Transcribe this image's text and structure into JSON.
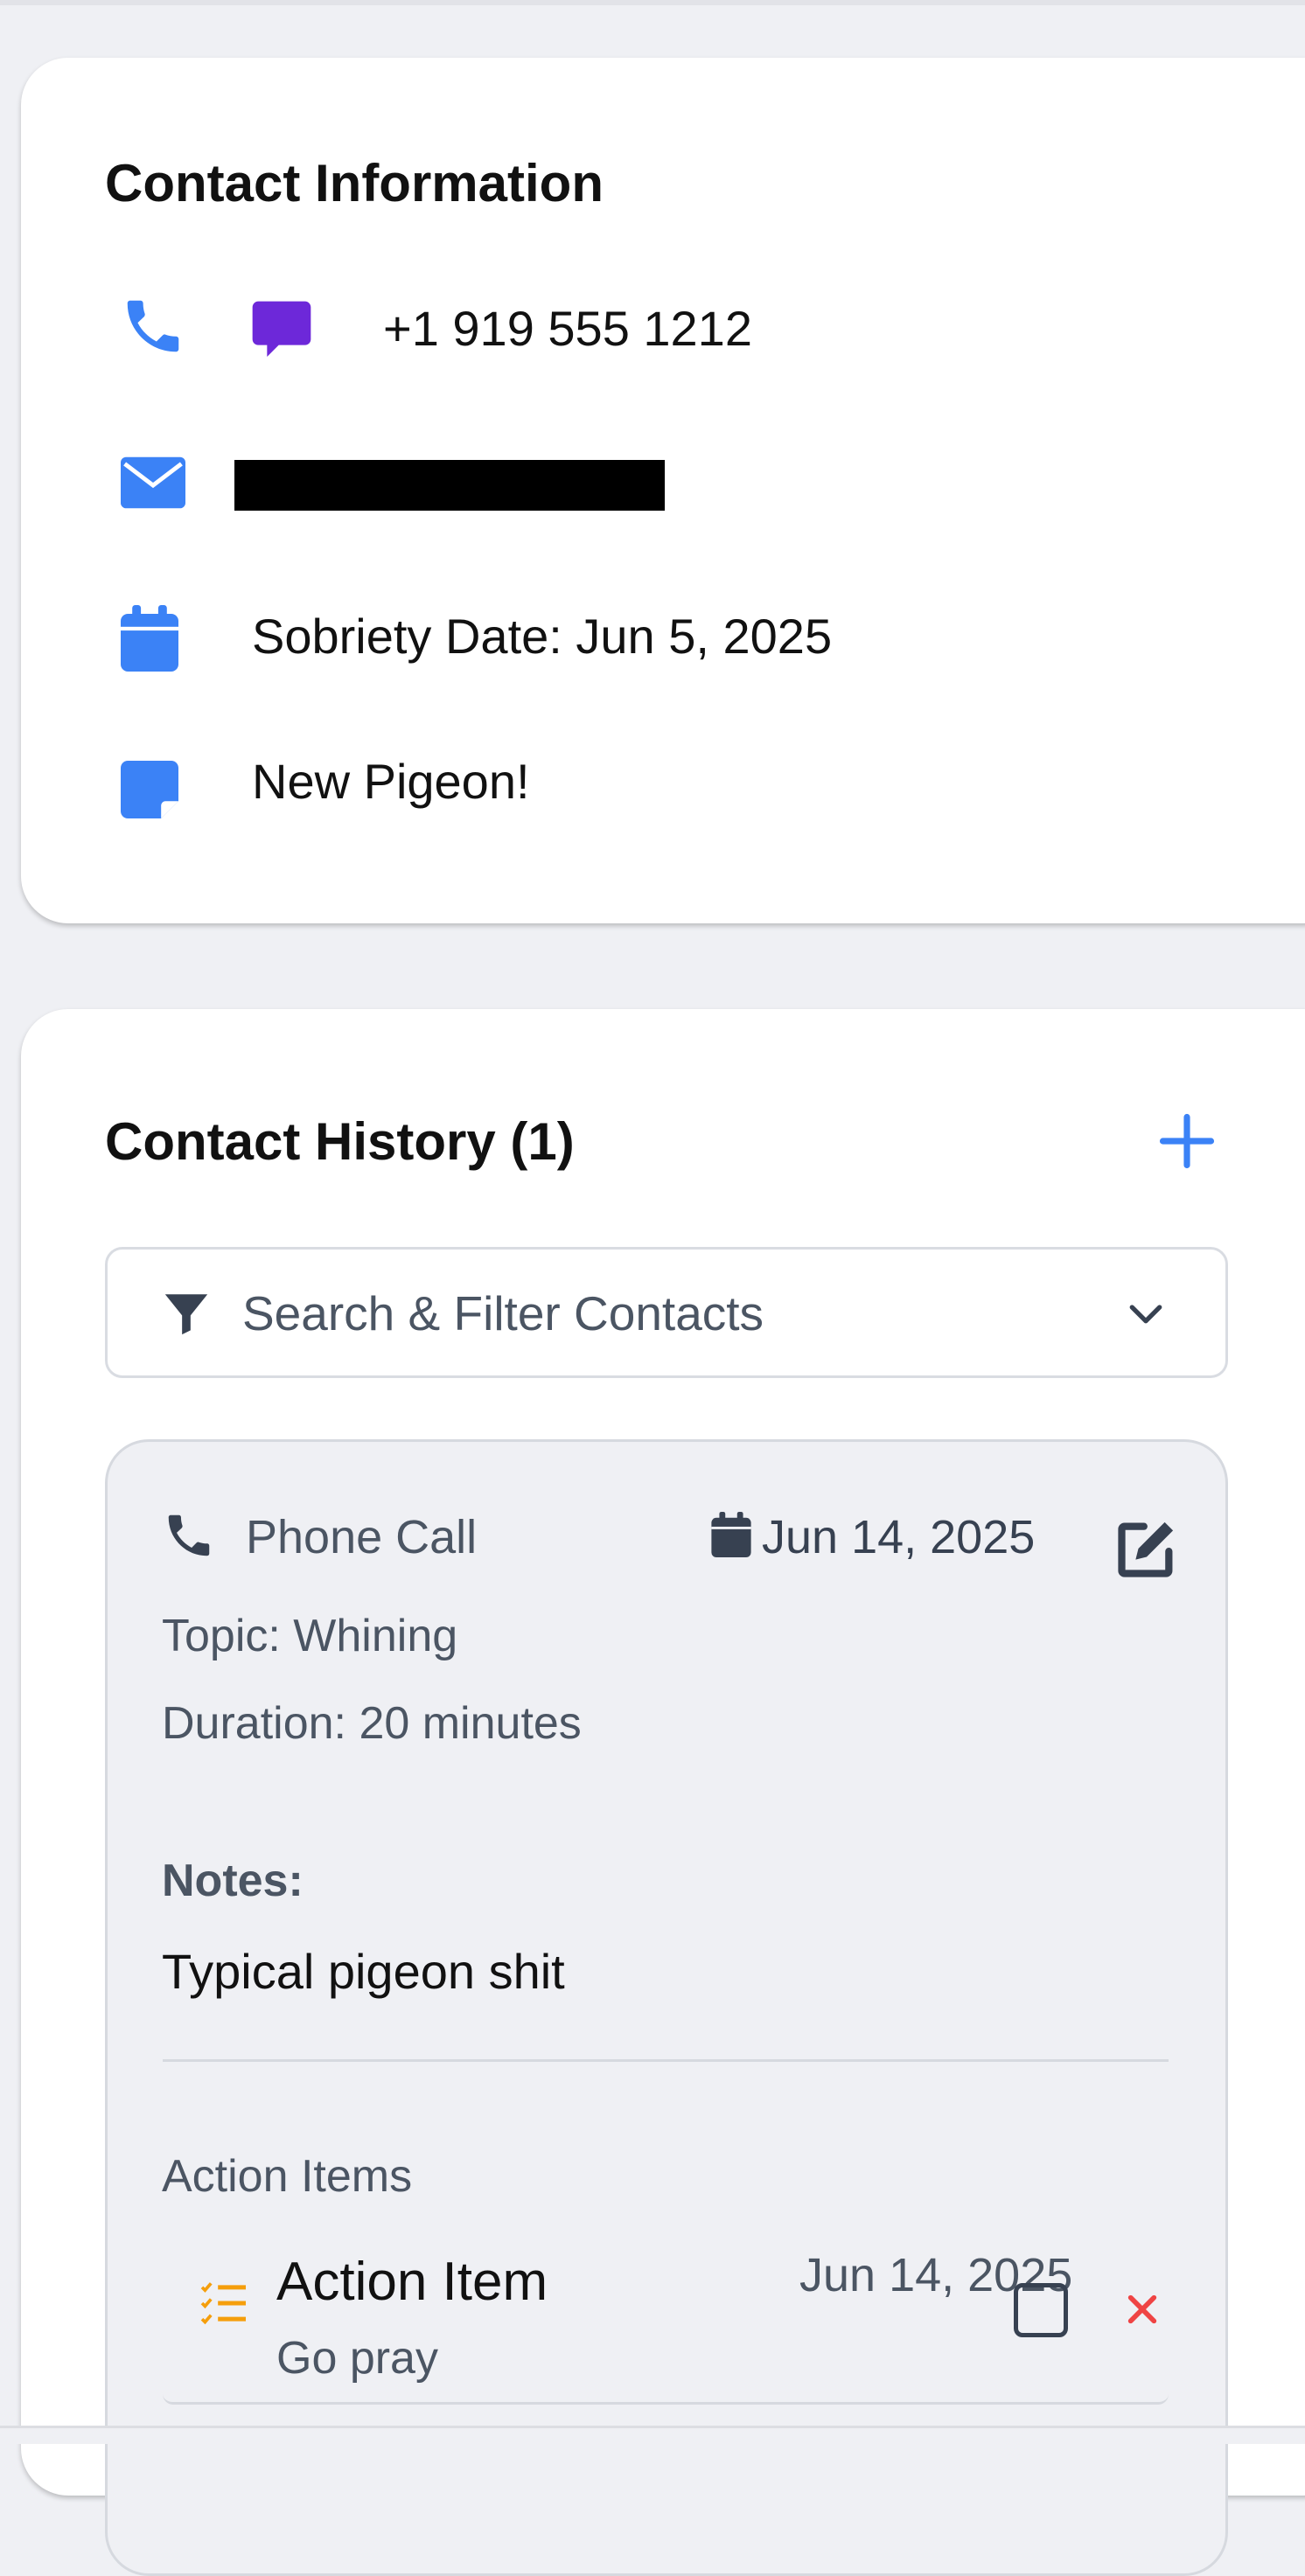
{
  "contact_info": {
    "title": "Contact Information",
    "phone": "+1 919 555 1212",
    "sobriety_date": "Sobriety Date: Jun 5, 2025",
    "note": "New Pigeon!",
    "icons": [
      "phone-icon",
      "message-icon",
      "envelope-icon",
      "calendar-icon",
      "sticky-note-icon"
    ]
  },
  "history": {
    "title": "Contact History (1)",
    "filter_label": "Search & Filter Contacts",
    "entries": [
      {
        "type": "Phone Call",
        "date": "Jun 14, 2025",
        "topic": "Topic: Whining",
        "duration": "Duration: 20 minutes",
        "notes_label": "Notes:",
        "notes": "Typical pigeon shit",
        "action_items_label": "Action Items",
        "action_items": [
          {
            "title": "Action Item",
            "text": "Go pray",
            "date": "Jun 14, 2025",
            "completed": false
          }
        ]
      }
    ]
  },
  "colors": {
    "accent_blue": "#3b82f6",
    "message_purple": "#6d28d9",
    "action_orange": "#f59e0b",
    "delete_red": "#ef4444"
  }
}
